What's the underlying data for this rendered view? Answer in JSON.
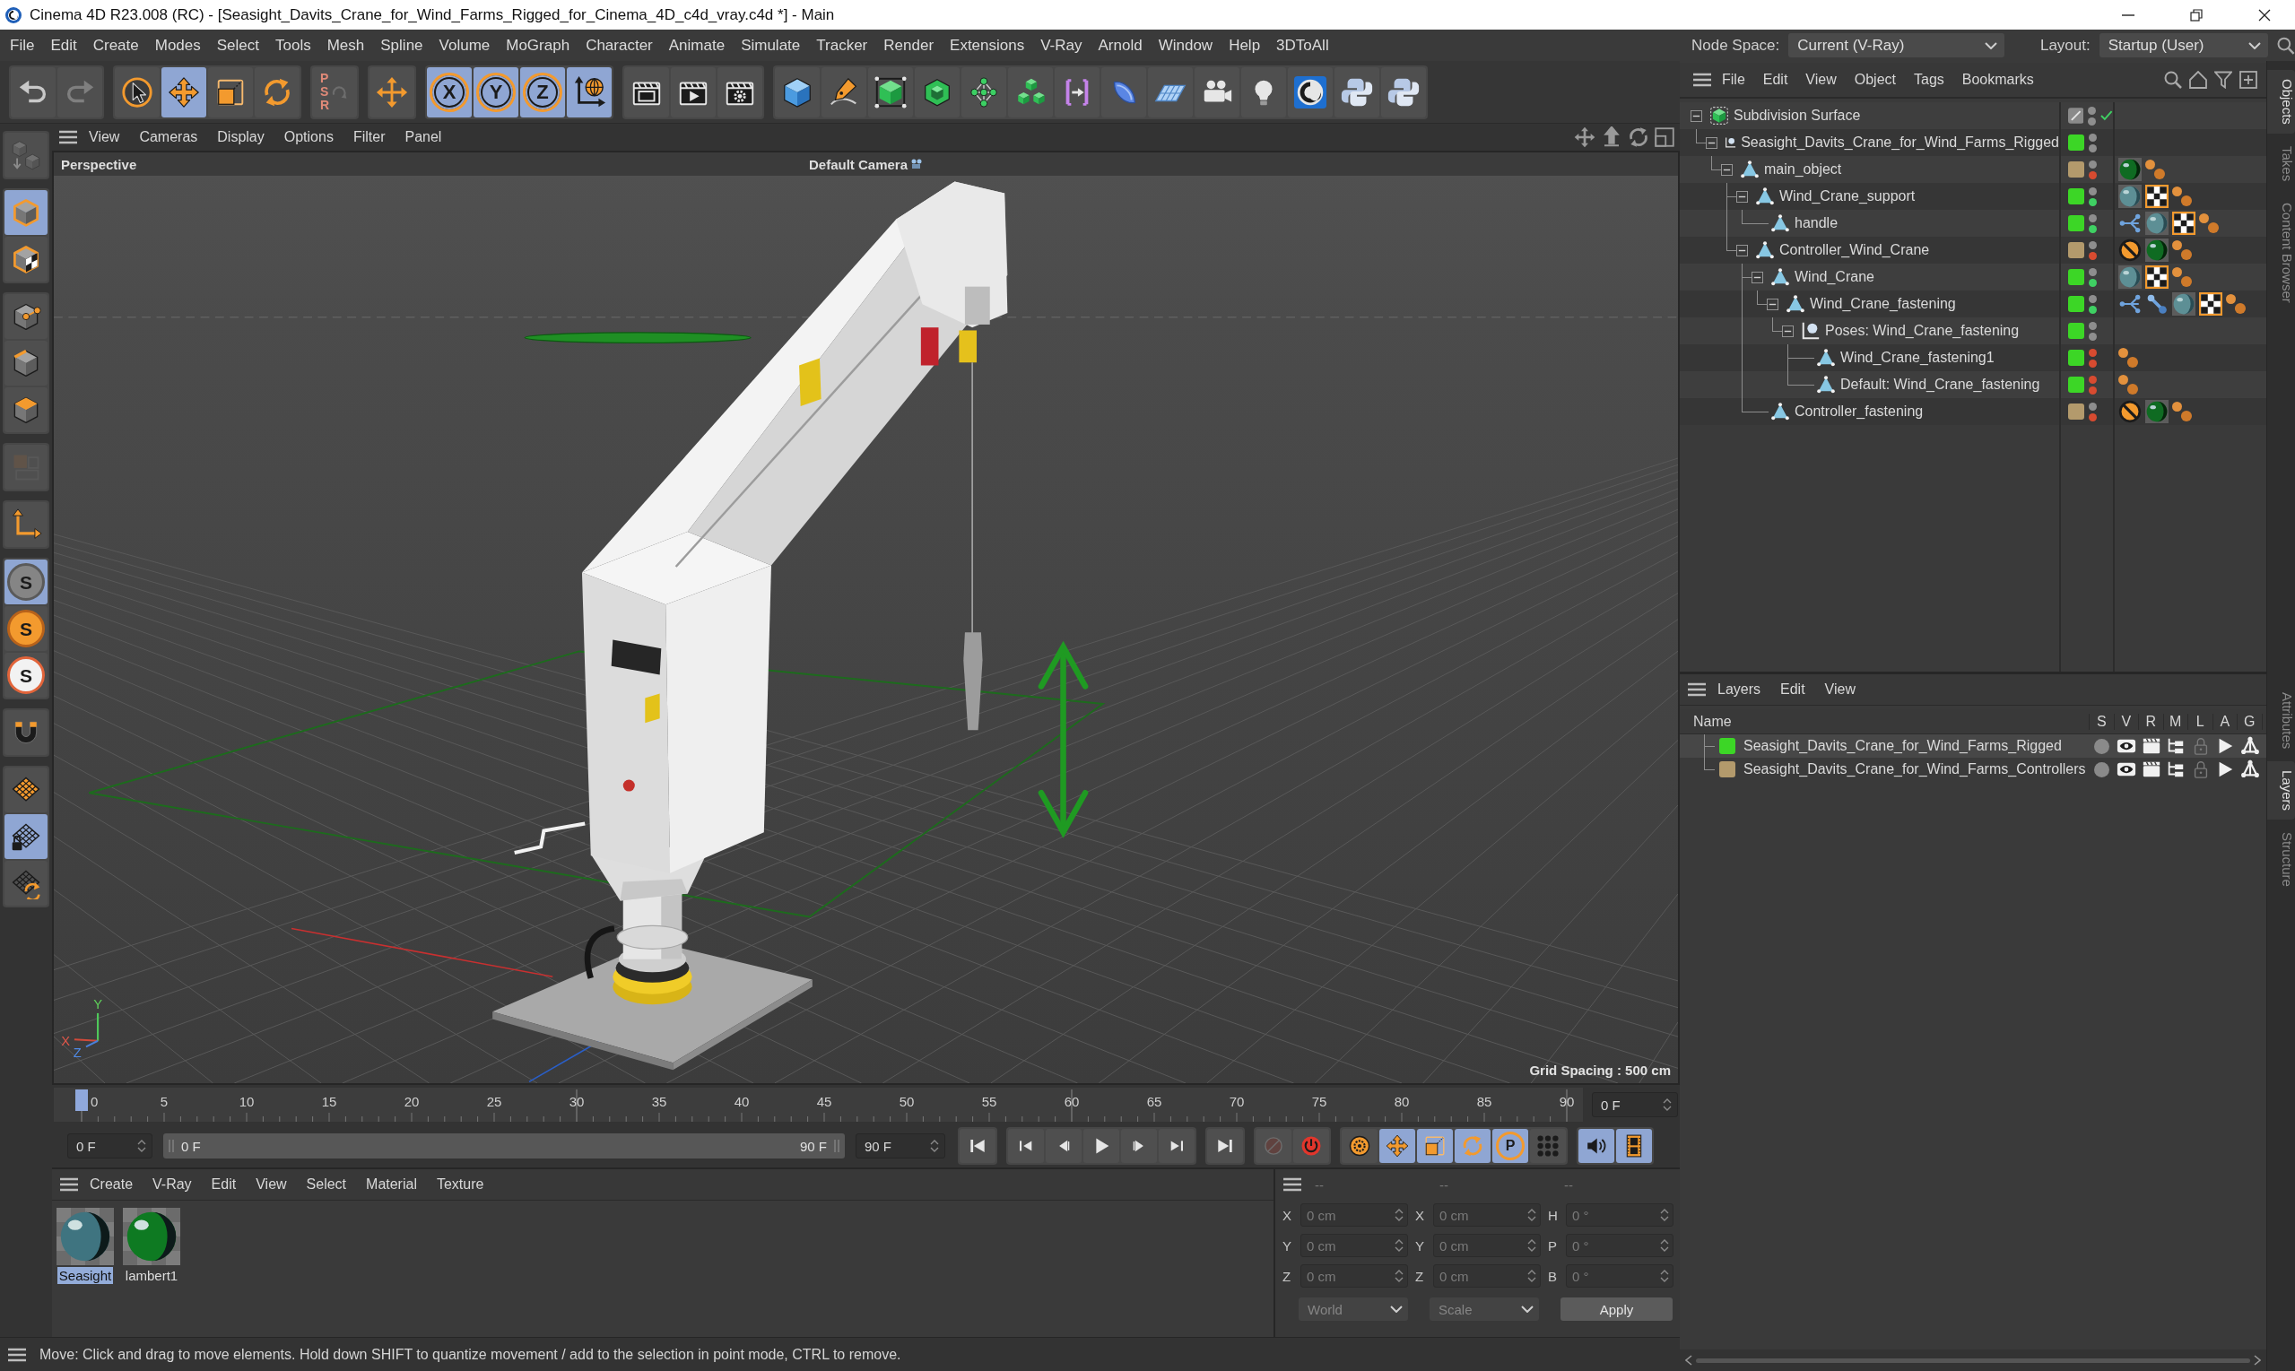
{
  "window": {
    "title": "Cinema 4D R23.008 (RC) - [Seasight_Davits_Crane_for_Wind_Farms_Rigged_for_Cinema_4D_c4d_vray.c4d *] - Main"
  },
  "menu_bar": [
    "File",
    "Edit",
    "Create",
    "Modes",
    "Select",
    "Tools",
    "Mesh",
    "Spline",
    "Volume",
    "MoGraph",
    "Character",
    "Animate",
    "Simulate",
    "Tracker",
    "Render",
    "Extensions",
    "V-Ray",
    "Arnold",
    "Window",
    "Help",
    "3DToAll"
  ],
  "node_space": {
    "label": "Node Space:",
    "value": "Current (V-Ray)"
  },
  "layout": {
    "label": "Layout:",
    "value": "Startup (User)"
  },
  "toolbar": [
    {
      "buttons": [
        {
          "kind": "undo",
          "selected": false,
          "disabled": false
        },
        {
          "kind": "redo",
          "selected": false,
          "disabled": true
        }
      ]
    },
    {
      "buttons": [
        {
          "kind": "select",
          "selected": false,
          "disabled": false
        },
        {
          "kind": "move",
          "selected": true,
          "disabled": false
        },
        {
          "kind": "scale",
          "selected": false,
          "disabled": false
        },
        {
          "kind": "rotate",
          "selected": false,
          "disabled": false
        }
      ]
    },
    {
      "buttons": [
        {
          "kind": "psr",
          "label": "PSR",
          "selected": false,
          "disabled": true
        }
      ]
    },
    {
      "buttons": [
        {
          "kind": "transform",
          "selected": false,
          "disabled": false
        }
      ]
    },
    {
      "buttons": [
        {
          "kind": "axis",
          "label": "X",
          "selected": true,
          "disabled": false
        },
        {
          "kind": "axis",
          "label": "Y",
          "selected": true,
          "disabled": false
        },
        {
          "kind": "axis",
          "label": "Z",
          "selected": true,
          "disabled": false
        },
        {
          "kind": "coordinates",
          "selected": true,
          "disabled": false
        }
      ]
    },
    {
      "buttons": [
        {
          "kind": "render_view",
          "selected": false,
          "disabled": false
        },
        {
          "kind": "render",
          "selected": false,
          "disabled": false
        },
        {
          "kind": "render_settings",
          "selected": false,
          "disabled": false
        }
      ]
    },
    {
      "buttons": [
        {
          "kind": "cube",
          "selected": false,
          "disabled": false
        },
        {
          "kind": "pen",
          "selected": false,
          "disabled": false
        },
        {
          "kind": "subdivision",
          "selected": false,
          "disabled": false
        },
        {
          "kind": "extrude",
          "selected": false,
          "disabled": false
        },
        {
          "kind": "cloner",
          "selected": false,
          "disabled": false
        },
        {
          "kind": "array",
          "selected": false,
          "disabled": false
        },
        {
          "kind": "deformer",
          "selected": false,
          "disabled": false
        },
        {
          "kind": "field",
          "selected": false,
          "disabled": false
        },
        {
          "kind": "floor",
          "selected": false,
          "disabled": false
        },
        {
          "kind": "camera",
          "selected": false,
          "disabled": false
        },
        {
          "kind": "light",
          "selected": false,
          "disabled": false
        },
        {
          "kind": "logo",
          "selected": false,
          "disabled": false
        },
        {
          "kind": "script",
          "selected": false,
          "disabled": false
        },
        {
          "kind": "script",
          "selected": false,
          "disabled": false
        }
      ]
    }
  ],
  "mode_toolbar": [
    {
      "buttons": [
        {
          "kind": "make_editable",
          "selected": false,
          "disabled": true
        }
      ]
    },
    {
      "buttons": [
        {
          "kind": "model_mode",
          "selected": true,
          "disabled": false
        },
        {
          "kind": "texture_mode",
          "selected": false,
          "disabled": false
        }
      ]
    },
    {
      "buttons": [
        {
          "kind": "point_mode",
          "selected": false,
          "disabled": false
        },
        {
          "kind": "edge_mode",
          "selected": false,
          "disabled": false
        },
        {
          "kind": "polygon_mode",
          "selected": false,
          "disabled": false
        }
      ]
    },
    {
      "buttons": [
        {
          "kind": "uv_mode",
          "selected": false,
          "disabled": true
        }
      ]
    },
    {
      "buttons": [
        {
          "kind": "axis_mode",
          "selected": false,
          "disabled": false
        }
      ]
    },
    {
      "buttons": [
        {
          "kind": "solo_view",
          "label": "S",
          "selected": true,
          "disabled": false
        },
        {
          "kind": "solo_single",
          "label": "S",
          "selected": false,
          "disabled": false
        },
        {
          "kind": "solo_off",
          "label": "S",
          "selected": false,
          "disabled": false
        }
      ]
    },
    {
      "buttons": [
        {
          "kind": "snap",
          "selected": false,
          "disabled": false
        }
      ]
    },
    {
      "buttons": [
        {
          "kind": "workplane",
          "selected": false,
          "disabled": false
        },
        {
          "kind": "workplane_lock",
          "selected": true,
          "disabled": false
        },
        {
          "kind": "workplane_align",
          "selected": false,
          "disabled": false
        }
      ]
    }
  ],
  "viewport": {
    "menu": [
      "View",
      "Cameras",
      "Display",
      "Options",
      "Filter",
      "Panel"
    ],
    "projection": "Perspective",
    "camera": "Default Camera",
    "grid_spacing": "Grid Spacing : 500 cm",
    "axis_labels": [
      "Y",
      "X",
      "Z"
    ]
  },
  "timeline": {
    "ticks": [
      "0",
      "5",
      "10",
      "15",
      "20",
      "25",
      "30",
      "35",
      "40",
      "45",
      "50",
      "55",
      "60",
      "65",
      "70",
      "75",
      "80",
      "85",
      "90"
    ],
    "playhead": {
      "level": 0
    },
    "current_frame": "0 F",
    "start_frame": "0 F",
    "range": {
      "start": "0 F",
      "end": "90 F",
      "level": 1
    },
    "end_frame": "90 F",
    "transport": [
      {
        "buttons": [
          {
            "kind": "go_start",
            "selected": false,
            "disabled": false
          }
        ]
      },
      {
        "buttons": [
          {
            "kind": "prev_key",
            "selected": false,
            "disabled": false
          },
          {
            "kind": "prev_frame",
            "selected": false,
            "disabled": false
          },
          {
            "kind": "play",
            "selected": false,
            "disabled": false
          },
          {
            "kind": "next_frame",
            "selected": false,
            "disabled": false
          },
          {
            "kind": "next_key",
            "selected": false,
            "disabled": false
          }
        ]
      },
      {
        "buttons": [
          {
            "kind": "go_end",
            "selected": false,
            "disabled": false
          }
        ]
      },
      {
        "buttons": [
          {
            "kind": "record",
            "selected": false,
            "disabled": true
          },
          {
            "kind": "autokey",
            "selected": false,
            "disabled": false
          }
        ]
      },
      {
        "buttons": [
          {
            "kind": "key_selection",
            "selected": false,
            "disabled": false
          },
          {
            "kind": "key_position",
            "selected": true,
            "disabled": false
          },
          {
            "kind": "key_scale",
            "selected": true,
            "disabled": false
          },
          {
            "kind": "key_rotation",
            "selected": true,
            "disabled": false
          },
          {
            "kind": "key_parameter",
            "label": "P",
            "selected": true,
            "disabled": false
          },
          {
            "kind": "key_pla",
            "selected": false,
            "disabled": false
          }
        ]
      },
      {
        "buttons": [
          {
            "kind": "sound",
            "selected": true,
            "disabled": false
          },
          {
            "kind": "timeline_view",
            "selected": true,
            "disabled": false
          }
        ]
      }
    ]
  },
  "material_manager": {
    "menu": [
      "Create",
      "V-Ray",
      "Edit",
      "View",
      "Select",
      "Material",
      "Texture"
    ],
    "materials": [
      {
        "name": "Seasight",
        "color": "#3f7480",
        "selected": true
      },
      {
        "name": "lambert1",
        "color": "#0e7a22",
        "selected": false
      }
    ]
  },
  "coordinates": {
    "disabled": true,
    "headers": [
      "--",
      "--",
      "--"
    ],
    "rows": [
      {
        "fields": [
          {
            "axis": "X",
            "value": "0 cm"
          },
          {
            "axis": "X",
            "value": "0 cm"
          },
          {
            "axis": "H",
            "value": "0 °"
          }
        ]
      },
      {
        "fields": [
          {
            "axis": "Y",
            "value": "0 cm"
          },
          {
            "axis": "Y",
            "value": "0 cm"
          },
          {
            "axis": "P",
            "value": "0 °"
          }
        ]
      },
      {
        "fields": [
          {
            "axis": "Z",
            "value": "0 cm"
          },
          {
            "axis": "Z",
            "value": "0 cm"
          },
          {
            "axis": "B",
            "value": "0 °"
          }
        ]
      }
    ],
    "mode": "World",
    "transform": "Scale",
    "apply": "Apply"
  },
  "status_bar": {
    "text": "Move: Click and drag to move elements. Hold down SHIFT to quantize movement / add to the selection in point mode, CTRL to remove."
  },
  "object_manager": {
    "menu": [
      "File",
      "Edit",
      "View",
      "Object",
      "Tags",
      "Bookmarks"
    ],
    "tree": [
      {
        "name": "Subdivision Surface",
        "kind": "subdivision",
        "expanded": true,
        "selected": false,
        "dots": [
          {
            "color": "#8e8e8e"
          },
          {
            "color": "#8e8e8e"
          }
        ],
        "enabled": true,
        "children": [
          {
            "name": "Seasight_Davits_Crane_for_Wind_Farms_Rigged",
            "kind": "pose",
            "expanded": true,
            "selected": false,
            "color": "#3cd626",
            "dots": [
              {
                "color": "#8e8e8e"
              },
              {
                "color": "#8e8e8e"
              }
            ],
            "children": [
              {
                "name": "main_object",
                "kind": "polygon",
                "expanded": true,
                "selected": false,
                "color": "#b39a6c",
                "dots": [
                  {
                    "color": "#8e8e8e"
                  },
                  {
                    "color": "#d84b30"
                  }
                ],
                "tags": [
                  {
                    "kind": "material_green"
                  },
                  {
                    "kind": "phong"
                  }
                ],
                "children": [
                  {
                    "name": "Wind_Crane_support",
                    "kind": "polygon",
                    "expanded": true,
                    "selected": false,
                    "color": "#3cd626",
                    "dots": [
                      {
                        "color": "#8e8e8e"
                      },
                      {
                        "color": "#3fd063"
                      }
                    ],
                    "tags": [
                      {
                        "kind": "material_teal"
                      },
                      {
                        "kind": "texture"
                      },
                      {
                        "kind": "phong"
                      }
                    ],
                    "children": [
                      {
                        "name": "handle",
                        "kind": "polygon",
                        "selected": false,
                        "color": "#3cd626",
                        "dots": [
                          {
                            "color": "#8e8e8e"
                          },
                          {
                            "color": "#3fd063"
                          }
                        ],
                        "tags": [
                          {
                            "kind": "weight"
                          },
                          {
                            "kind": "material_teal"
                          },
                          {
                            "kind": "texture"
                          },
                          {
                            "kind": "phong"
                          }
                        ]
                      }
                    ]
                  },
                  {
                    "name": "Controller_Wind_Crane",
                    "kind": "polygon",
                    "expanded": true,
                    "selected": false,
                    "color": "#b39a6c",
                    "dots": [
                      {
                        "color": "#8e8e8e"
                      },
                      {
                        "color": "#d84b30"
                      }
                    ],
                    "tags": [
                      {
                        "kind": "protection"
                      },
                      {
                        "kind": "material_green"
                      },
                      {
                        "kind": "phong"
                      }
                    ],
                    "children": [
                      {
                        "name": "Wind_Crane",
                        "kind": "polygon",
                        "expanded": true,
                        "selected": false,
                        "color": "#3cd626",
                        "dots": [
                          {
                            "color": "#8e8e8e"
                          },
                          {
                            "color": "#3fd063"
                          }
                        ],
                        "tags": [
                          {
                            "kind": "material_teal"
                          },
                          {
                            "kind": "texture"
                          },
                          {
                            "kind": "phong"
                          }
                        ],
                        "children": [
                          {
                            "name": "Wind_Crane_fastening",
                            "kind": "polygon",
                            "expanded": true,
                            "selected": false,
                            "color": "#3cd626",
                            "dots": [
                              {
                                "color": "#8e8e8e"
                              },
                              {
                                "color": "#3fd063"
                              }
                            ],
                            "tags": [
                              {
                                "kind": "weight"
                              },
                              {
                                "kind": "joint"
                              },
                              {
                                "kind": "material_teal"
                              },
                              {
                                "kind": "texture"
                              },
                              {
                                "kind": "phong"
                              }
                            ],
                            "children": [
                              {
                                "name": "Poses: Wind_Crane_fastening",
                                "kind": "pose",
                                "expanded": true,
                                "selected": false,
                                "color": "#3cd626",
                                "dots": [
                                  {
                                    "color": "#8e8e8e"
                                  },
                                  {
                                    "color": "#8e8e8e"
                                  }
                                ],
                                "children": [
                                  {
                                    "name": "Wind_Crane_fastening1",
                                    "kind": "polygon",
                                    "selected": false,
                                    "color": "#3cd626",
                                    "dots": [
                                      {
                                        "color": "#d84b30"
                                      },
                                      {
                                        "color": "#d84b30"
                                      }
                                    ],
                                    "tags": [
                                      {
                                        "kind": "phong"
                                      }
                                    ]
                                  },
                                  {
                                    "name": "Default: Wind_Crane_fastening",
                                    "kind": "polygon",
                                    "selected": false,
                                    "color": "#3cd626",
                                    "dots": [
                                      {
                                        "color": "#d84b30"
                                      },
                                      {
                                        "color": "#d84b30"
                                      }
                                    ],
                                    "tags": [
                                      {
                                        "kind": "phong"
                                      }
                                    ]
                                  }
                                ]
                              }
                            ]
                          }
                        ]
                      },
                      {
                        "name": "Controller_fastening",
                        "kind": "polygon",
                        "selected": false,
                        "color": "#b39a6c",
                        "dots": [
                          {
                            "color": "#8e8e8e"
                          },
                          {
                            "color": "#d84b30"
                          }
                        ],
                        "tags": [
                          {
                            "kind": "protection"
                          },
                          {
                            "kind": "material_green"
                          },
                          {
                            "kind": "phong"
                          }
                        ]
                      }
                    ]
                  }
                ]
              }
            ]
          }
        ]
      }
    ]
  },
  "layer_manager": {
    "menu": [
      "Layers",
      "Edit",
      "View"
    ],
    "columns": [
      "Name",
      "S",
      "V",
      "R",
      "M",
      "L",
      "A",
      "G"
    ],
    "layers": [
      {
        "name": "Seasight_Davits_Crane_for_Wind_Farms_Rigged",
        "color": "#3cd626",
        "selected": true,
        "solo": false,
        "visible": true,
        "render": true,
        "manager": true,
        "locked": false,
        "animation": true,
        "generators": true
      },
      {
        "name": "Seasight_Davits_Crane_for_Wind_Farms_Controllers",
        "color": "#b39a6c",
        "selected": false,
        "solo": false,
        "visible": true,
        "render": true,
        "manager": true,
        "locked": false,
        "animation": true,
        "generators": true
      }
    ]
  },
  "side_tabs": {
    "top": [
      {
        "label": "Objects",
        "selected": true
      },
      {
        "label": "Takes",
        "selected": false
      },
      {
        "label": "Content Browser",
        "selected": false
      }
    ],
    "bottom": [
      {
        "label": "Attributes",
        "selected": false
      },
      {
        "label": "Layers",
        "selected": true
      },
      {
        "label": "Structure",
        "selected": false
      }
    ]
  }
}
